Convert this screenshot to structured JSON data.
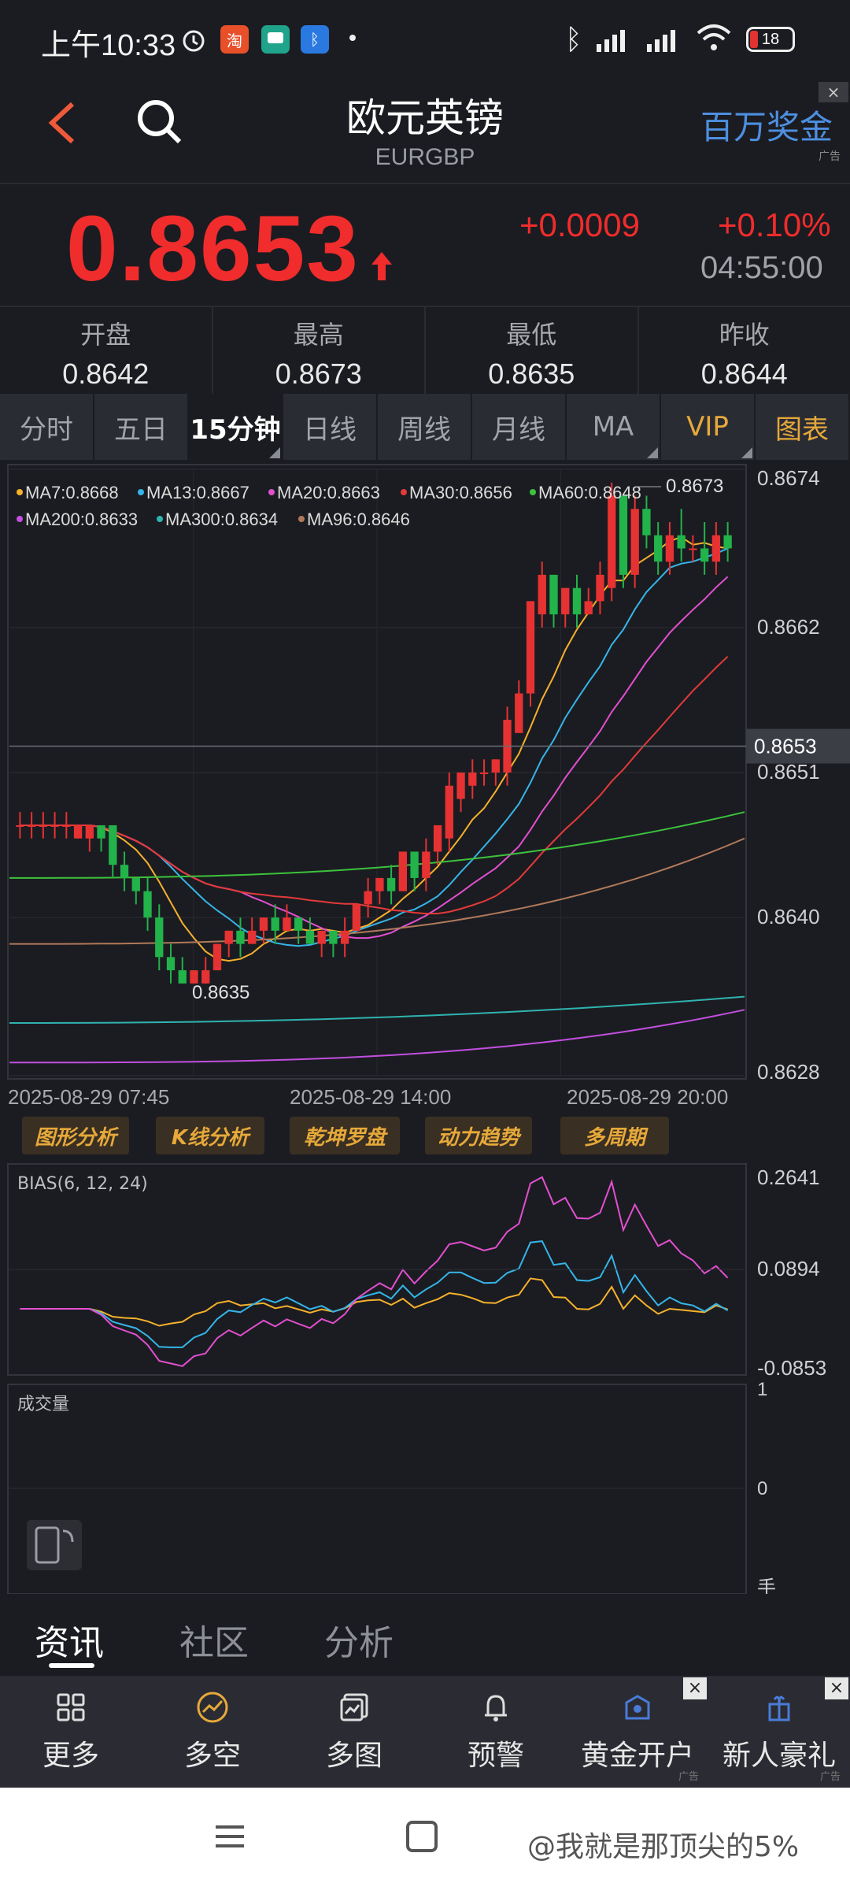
{
  "status_bar": {
    "time": "上午10:33",
    "battery": "18",
    "icons": [
      "alarm-icon",
      "taobao-app-icon",
      "message-app-icon",
      "bluetooth-app-icon",
      "dot-icon",
      "bluetooth-icon",
      "hd-signal-icon",
      "hd-signal-icon",
      "wifi-icon",
      "battery-icon"
    ]
  },
  "header": {
    "title": "欧元英镑",
    "subtitle": "EURGBP",
    "ad_label": "百万奖金",
    "ad_tag": "广告",
    "close": "×"
  },
  "quote": {
    "price": "0.8653",
    "change": "+0.0009",
    "change_pct": "+0.10%",
    "time": "04:55:00",
    "up_color": "#f02c2c"
  },
  "stats": [
    {
      "label": "开盘",
      "value": "0.8642"
    },
    {
      "label": "最高",
      "value": "0.8673"
    },
    {
      "label": "最低",
      "value": "0.8635"
    },
    {
      "label": "昨收",
      "value": "0.8644"
    }
  ],
  "tabs": [
    {
      "label": "分时"
    },
    {
      "label": "五日"
    },
    {
      "label": "15分钟"
    },
    {
      "label": "日线"
    },
    {
      "label": "周线"
    },
    {
      "label": "月线"
    },
    {
      "label": "MA"
    },
    {
      "label": "VIP"
    },
    {
      "label": "图表"
    }
  ],
  "chart_data": {
    "type": "candlestick",
    "interval": "15分钟",
    "ma_legend": [
      {
        "name": "MA7",
        "value": "0.8668",
        "color": "#f5b12c"
      },
      {
        "name": "MA13",
        "value": "0.8667",
        "color": "#35b5e8"
      },
      {
        "name": "MA20",
        "value": "0.8663",
        "color": "#e24fd0"
      },
      {
        "name": "MA30",
        "value": "0.8656",
        "color": "#e33a3a"
      },
      {
        "name": "MA60",
        "value": "0.8648",
        "color": "#3cc23c"
      },
      {
        "name": "MA200",
        "value": "0.8633",
        "color": "#c24fe0"
      },
      {
        "name": "MA300",
        "value": "0.8634",
        "color": "#2fb3b0"
      },
      {
        "name": "MA96",
        "value": "0.8646",
        "color": "#b07a5a"
      }
    ],
    "y_ticks": [
      "0.8674",
      "0.8662",
      "0.8651",
      "0.8640",
      "0.8628"
    ],
    "ylim": [
      0.8628,
      0.8674
    ],
    "last_price_label": "0.8653",
    "high_label": "0.8673",
    "low_label": "0.8635",
    "x_ticks": [
      "2025-08-29 07:45",
      "2025-08-29 14:00",
      "2025-08-29 20:00"
    ],
    "candles": [
      [
        0.8647,
        0.8647,
        0.8648,
        0.8646
      ],
      [
        0.8647,
        0.8647,
        0.8648,
        0.8646
      ],
      [
        0.8647,
        0.8647,
        0.8648,
        0.8646
      ],
      [
        0.8647,
        0.8647,
        0.8648,
        0.8646
      ],
      [
        0.8647,
        0.8647,
        0.8648,
        0.8646
      ],
      [
        0.8646,
        0.8647,
        0.8647,
        0.8646
      ],
      [
        0.8646,
        0.8647,
        0.8647,
        0.8645
      ],
      [
        0.8647,
        0.8646,
        0.8647,
        0.8645
      ],
      [
        0.8647,
        0.8644,
        0.8647,
        0.8643
      ],
      [
        0.8644,
        0.8643,
        0.8645,
        0.8642
      ],
      [
        0.8643,
        0.8642,
        0.8643,
        0.8641
      ],
      [
        0.8642,
        0.864,
        0.8643,
        0.8639
      ],
      [
        0.864,
        0.8637,
        0.8641,
        0.8636
      ],
      [
        0.8637,
        0.8636,
        0.8638,
        0.8635
      ],
      [
        0.8636,
        0.8635,
        0.8637,
        0.8635
      ],
      [
        0.8635,
        0.8636,
        0.8636,
        0.8635
      ],
      [
        0.8635,
        0.8636,
        0.8637,
        0.8635
      ],
      [
        0.8636,
        0.8638,
        0.8638,
        0.8636
      ],
      [
        0.8638,
        0.8639,
        0.8639,
        0.8637
      ],
      [
        0.8639,
        0.8638,
        0.864,
        0.8637
      ],
      [
        0.8638,
        0.8639,
        0.864,
        0.8638
      ],
      [
        0.8639,
        0.864,
        0.864,
        0.8638
      ],
      [
        0.864,
        0.8639,
        0.8641,
        0.8638
      ],
      [
        0.8639,
        0.864,
        0.8641,
        0.8639
      ],
      [
        0.864,
        0.8639,
        0.864,
        0.8638
      ],
      [
        0.8639,
        0.8638,
        0.864,
        0.8638
      ],
      [
        0.8638,
        0.8639,
        0.8639,
        0.8637
      ],
      [
        0.8639,
        0.8638,
        0.8639,
        0.8637
      ],
      [
        0.8638,
        0.8639,
        0.864,
        0.8637
      ],
      [
        0.8639,
        0.8641,
        0.8641,
        0.8639
      ],
      [
        0.8641,
        0.8642,
        0.8643,
        0.864
      ],
      [
        0.8642,
        0.8643,
        0.8643,
        0.8641
      ],
      [
        0.8643,
        0.8642,
        0.8644,
        0.8641
      ],
      [
        0.8642,
        0.8645,
        0.8645,
        0.8642
      ],
      [
        0.8645,
        0.8643,
        0.8645,
        0.8642
      ],
      [
        0.8643,
        0.8645,
        0.8646,
        0.8642
      ],
      [
        0.8645,
        0.8647,
        0.8647,
        0.8644
      ],
      [
        0.8646,
        0.865,
        0.8651,
        0.8645
      ],
      [
        0.8649,
        0.8651,
        0.8651,
        0.8648
      ],
      [
        0.865,
        0.8651,
        0.8652,
        0.8649
      ],
      [
        0.8651,
        0.8651,
        0.8652,
        0.865
      ],
      [
        0.8651,
        0.8652,
        0.8652,
        0.865
      ],
      [
        0.8651,
        0.8655,
        0.8656,
        0.865
      ],
      [
        0.8654,
        0.8657,
        0.8658,
        0.8654
      ],
      [
        0.8657,
        0.8664,
        0.8664,
        0.8656
      ],
      [
        0.8663,
        0.8666,
        0.8667,
        0.8662
      ],
      [
        0.8666,
        0.8663,
        0.8666,
        0.8662
      ],
      [
        0.8663,
        0.8665,
        0.8665,
        0.8662
      ],
      [
        0.8665,
        0.8663,
        0.8666,
        0.8662
      ],
      [
        0.8663,
        0.8664,
        0.8665,
        0.8663
      ],
      [
        0.8664,
        0.8666,
        0.8667,
        0.8663
      ],
      [
        0.8665,
        0.8672,
        0.8673,
        0.8664
      ],
      [
        0.8672,
        0.8666,
        0.8672,
        0.8665
      ],
      [
        0.8666,
        0.8671,
        0.8672,
        0.8665
      ],
      [
        0.8671,
        0.8669,
        0.8672,
        0.8668
      ],
      [
        0.8669,
        0.8667,
        0.867,
        0.8666
      ],
      [
        0.8667,
        0.8669,
        0.867,
        0.8666
      ],
      [
        0.8669,
        0.8668,
        0.8671,
        0.8667
      ],
      [
        0.8668,
        0.8668,
        0.8669,
        0.8667
      ],
      [
        0.8668,
        0.8667,
        0.867,
        0.8666
      ],
      [
        0.8667,
        0.8669,
        0.867,
        0.8666
      ],
      [
        0.8669,
        0.8668,
        0.867,
        0.8667
      ]
    ],
    "bias": {
      "title": "BIAS(6, 12, 24)",
      "y_ticks": [
        "0.2641",
        "0.0894",
        "-0.0853"
      ]
    },
    "volume": {
      "title": "成交量",
      "y_ticks": [
        "1",
        "0"
      ],
      "unit": "手"
    }
  },
  "tools": [
    "图形分析",
    "K线分析",
    "乾坤罗盘",
    "动力趋势",
    "多周期"
  ],
  "info_tabs": [
    "资讯",
    "社区",
    "分析"
  ],
  "actions": [
    {
      "label": "更多",
      "icon": "grid-icon"
    },
    {
      "label": "多空",
      "icon": "trend-icon"
    },
    {
      "label": "多图",
      "icon": "multi-chart-icon"
    },
    {
      "label": "预警",
      "icon": "bell-icon"
    },
    {
      "label": "黄金开户",
      "icon": "gold-account-icon",
      "ad": "广告"
    },
    {
      "label": "新人豪礼",
      "icon": "gift-icon",
      "ad": "广告"
    }
  ],
  "watermark": "@我就是那顶尖的5%"
}
